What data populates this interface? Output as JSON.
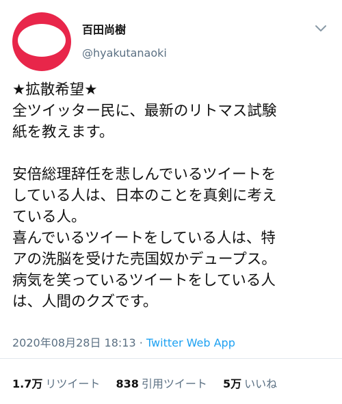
{
  "author": {
    "display_name": "百田尚樹",
    "handle": "@hyakutanaoki"
  },
  "tweet": {
    "lines": [
      "★拡散希望★",
      "全ツイッター民に、最新のリトマス試験",
      "紙を教えます。",
      "",
      "安倍総理辞任を悲しんでいるツイートを",
      "している人は、日本のことを真剣に考え",
      "ている人。",
      "喜んでいるツイートをしている人は、特",
      "アの洗脳を受けた売国奴かデュープス。",
      "病気を笑っているツイートをしている人",
      "は、人間のクズです。"
    ],
    "timestamp": "2020年08月28日 18:13",
    "separator": " · ",
    "via": "Twitter Web App"
  },
  "stats": {
    "retweets": {
      "value": "1.7万",
      "label": "リツイート"
    },
    "quotes": {
      "value": "838",
      "label": "引用ツイート"
    },
    "likes": {
      "value": "5万",
      "label": "いいね"
    }
  },
  "colors": {
    "avatar": "#e8264a",
    "muted": "#5b7083",
    "link": "#1da1f2"
  },
  "icons": {
    "menu": "chevron-down-icon"
  }
}
